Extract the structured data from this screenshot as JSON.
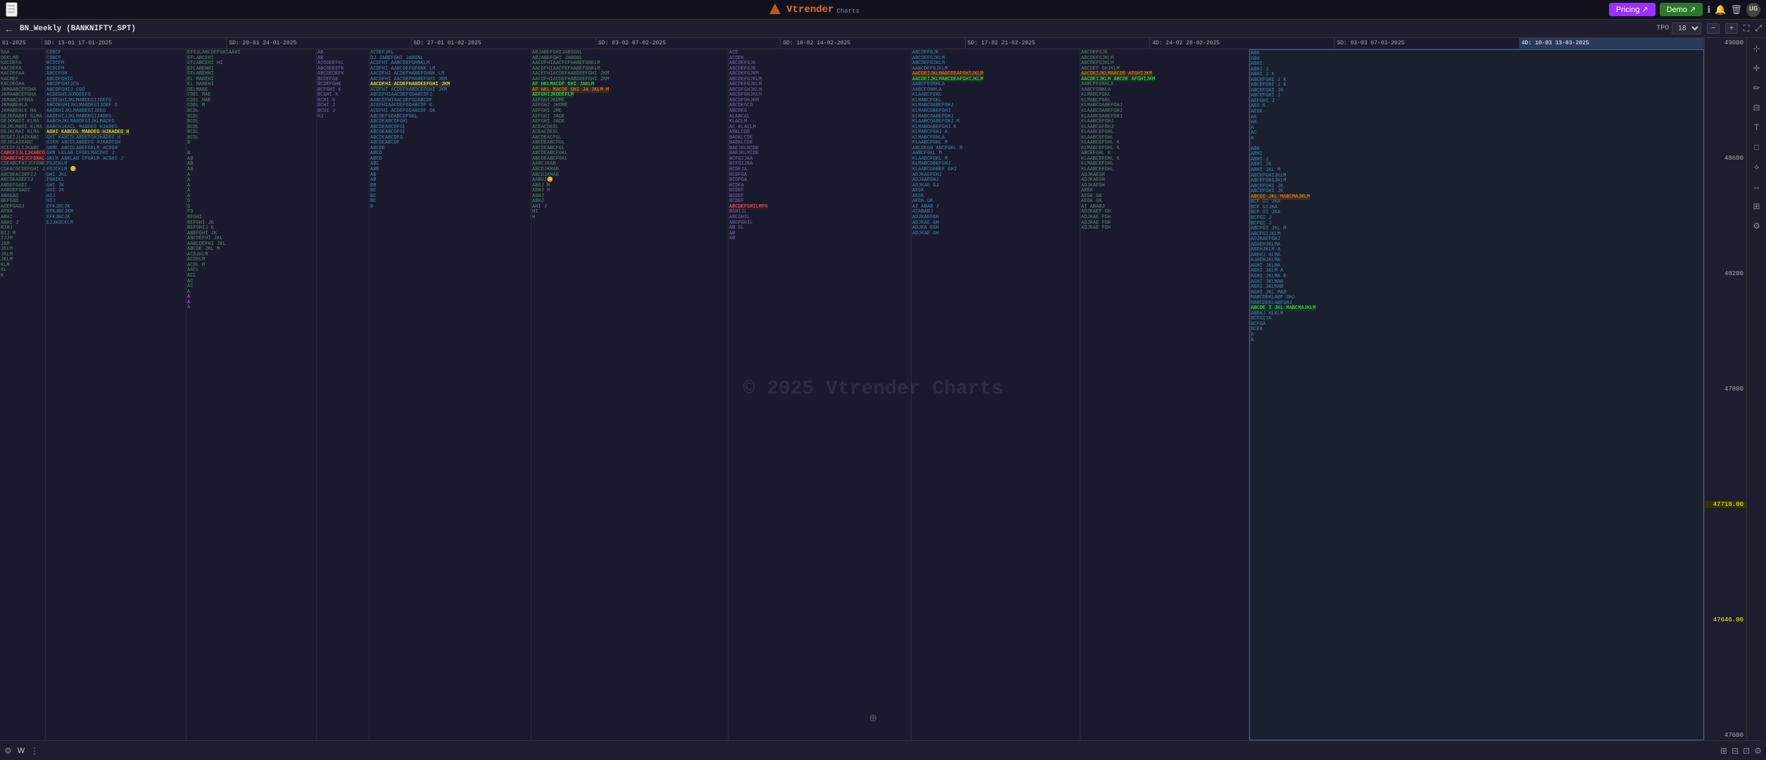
{
  "app": {
    "title": "Vtrender Charts",
    "logo_text": "Vtrender",
    "logo_sub": "Charts"
  },
  "nav": {
    "hamburger": "☰",
    "pricing_label": "Pricing ↗",
    "demo_label": "Demo ↗",
    "user_initials": "UG"
  },
  "toolbar": {
    "back_label": "←",
    "chart_title": "BN_Weekly (BANKNIFTY_SPT)",
    "tpo_label": "TPO",
    "tpo_value": "18",
    "btn_minus": "−",
    "btn_plus": "+",
    "fullscreen": "⛶",
    "expand": "⤢"
  },
  "dates": [
    "01-2025",
    "SD: 13-01  17-01-2025",
    "SD: 20-01  24-01-2025",
    "6D: 27-01  01-02-2025",
    "SD: 03-02  07-02-2025",
    "SD: 10-02  14-02-2025",
    "SD: 17-02  21-02-2025",
    "4D: 24-02  28-02-2025",
    "SD: 03-03  07-03-2025",
    "4D: 10-03  13-03-2025"
  ],
  "price_levels": [
    "49000",
    "48600",
    "48200",
    "47800",
    "47718.00",
    "47646.00",
    "47600"
  ],
  "watermark": "© 2025 Vtrender Charts",
  "bottom": {
    "settings_icon": "⚙",
    "w_label": "W",
    "more_icon": "⋮",
    "grid_icon": "⊞",
    "layout_icon": "⊟",
    "fit_icon": "⊡",
    "config_icon": "⚙"
  }
}
